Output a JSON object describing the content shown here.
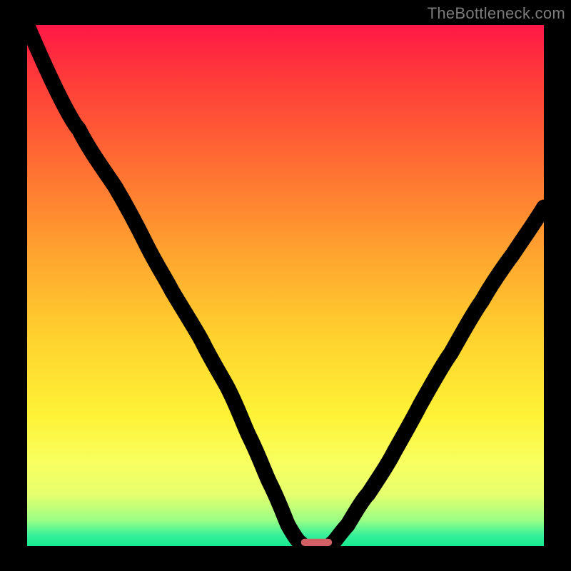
{
  "watermark": "TheBottleneck.com",
  "chart_data": {
    "type": "line",
    "title": "",
    "xlabel": "",
    "ylabel": "",
    "x_range": [
      0,
      100
    ],
    "y_range": [
      0,
      100
    ],
    "left_curve": {
      "x": [
        0,
        10,
        17,
        23,
        28,
        34,
        39,
        43,
        47,
        50.5,
        53
      ],
      "y": [
        100,
        80,
        69,
        58,
        49,
        39,
        30,
        21,
        12,
        4,
        0.5
      ]
    },
    "right_curve": {
      "x": [
        59,
        62,
        66,
        71,
        76,
        82,
        88,
        94,
        100
      ],
      "y": [
        0.5,
        4,
        10,
        18,
        27,
        37,
        47,
        56,
        65
      ]
    },
    "marker": {
      "x_start": 53,
      "x_end": 59,
      "y": 0.5,
      "color": "#d16064"
    },
    "gradient_stops": [
      {
        "pos": 0.0,
        "color": "#ff1846"
      },
      {
        "pos": 0.1,
        "color": "#ff3a3a"
      },
      {
        "pos": 0.26,
        "color": "#ff6b33"
      },
      {
        "pos": 0.44,
        "color": "#ffa42f"
      },
      {
        "pos": 0.6,
        "color": "#ffd22e"
      },
      {
        "pos": 0.75,
        "color": "#fef236"
      },
      {
        "pos": 0.84,
        "color": "#f8ff60"
      },
      {
        "pos": 0.9,
        "color": "#e6ff6d"
      },
      {
        "pos": 0.95,
        "color": "#9dff85"
      },
      {
        "pos": 0.98,
        "color": "#35f09a"
      },
      {
        "pos": 1.0,
        "color": "#17e890"
      }
    ]
  }
}
